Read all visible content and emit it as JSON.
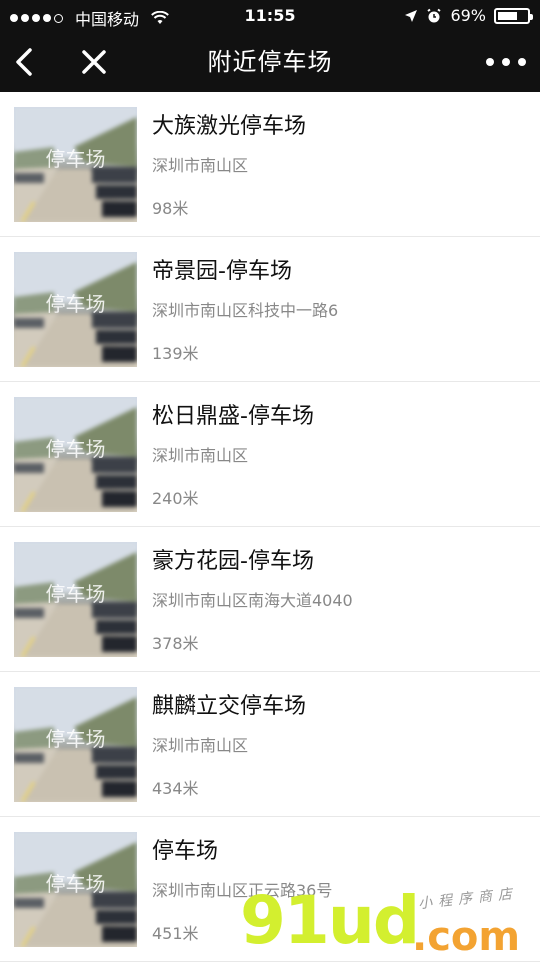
{
  "status_bar": {
    "carrier": "中国移动",
    "time": "11:55",
    "battery": "69%",
    "battery_level": 0.69
  },
  "nav": {
    "title": "附近停车场",
    "back_icon": "chevron-left-icon",
    "close_icon": "close-icon",
    "more_icon": "more-icon"
  },
  "thumbnail_caption": "停车场",
  "parking_lots": [
    {
      "name": "大族激光停车场",
      "address": "深圳市南山区",
      "distance": "98米"
    },
    {
      "name": "帝景园-停车场",
      "address": "深圳市南山区科技中一路6",
      "distance": "139米"
    },
    {
      "name": "松日鼎盛-停车场",
      "address": "深圳市南山区",
      "distance": "240米"
    },
    {
      "name": "豪方花园-停车场",
      "address": "深圳市南山区南海大道4040",
      "distance": "378米"
    },
    {
      "name": "麒麟立交停车场",
      "address": "深圳市南山区",
      "distance": "434米"
    },
    {
      "name": "停车场",
      "address": "深圳市南山区正云路36号",
      "distance": "451米"
    }
  ],
  "watermark": {
    "brand": "91ud",
    "domain": ".com",
    "tagline": "小程序商店"
  }
}
